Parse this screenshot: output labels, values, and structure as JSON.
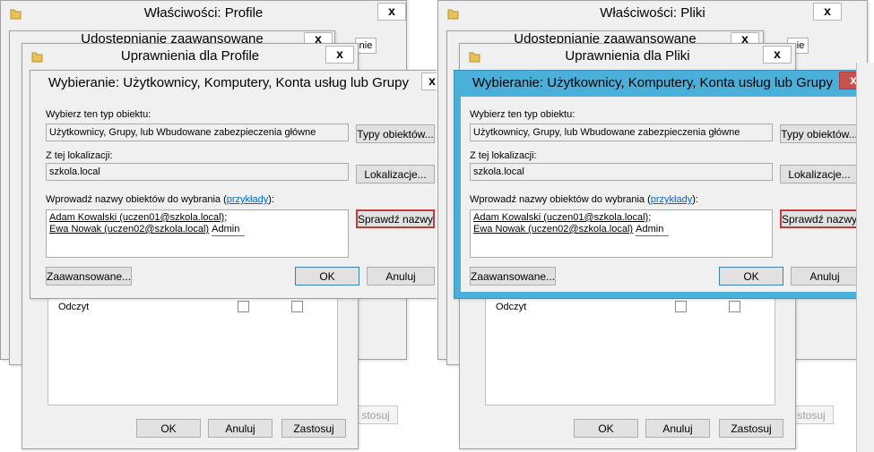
{
  "left": {
    "properties_title": "Właściwości: Profile",
    "advanced_title": "Udostępnianie zaawansowane",
    "permissions_title": "Uprawnienia dla Profile",
    "chooser_title": "Wybieranie: Użytkownicy, Komputery, Konta usług lub Grupy",
    "tab_fragment": "nie",
    "close_label": "x",
    "object_type_label": "Wybierz ten typ obiektu:",
    "object_type_value": "Użytkownicy, Grupy, lub Wbudowane zabezpieczenia główne",
    "object_types_button": "Typy obiektów...",
    "location_label": "Z tej lokalizacji:",
    "location_value": "szkola.local",
    "locations_button": "Lokalizacje...",
    "names_label_pre": "Wprowadź nazwy obiektów do wybrania (",
    "names_label_link": "przykłady",
    "names_label_post": "):",
    "entry1": "Adam Kowalski (uczen01@szkola.local)",
    "entry1_sep": ";",
    "entry2": "Ewa Nowak (uczen02@szkola.local)",
    "entry3": "Admin",
    "check_names_button": "Sprawdź nazwy",
    "advanced_button": "Zaawansowane...",
    "ok_button": "OK",
    "cancel_button": "Anuluj",
    "perm_row_label": "Odczyt",
    "perm_ok": "OK",
    "perm_cancel": "Anuluj",
    "perm_apply": "Zastosuj",
    "behind_apply_frag": "stosuj"
  },
  "right": {
    "properties_title": "Właściwości: Pliki",
    "advanced_title": "Udostępnianie zaawansowane",
    "permissions_title": "Uprawnienia dla Pliki",
    "chooser_title": "Wybieranie: Użytkownicy, Komputery, Konta usług lub Grupy",
    "tab_fragment": "nie",
    "close_label": "x",
    "object_type_label": "Wybierz ten typ obiektu:",
    "object_type_value": "Użytkownicy, Grupy, lub Wbudowane zabezpieczenia główne",
    "object_types_button": "Typy obiektów...",
    "location_label": "Z tej lokalizacji:",
    "location_value": "szkola.local",
    "locations_button": "Lokalizacje...",
    "names_label_pre": "Wprowadź nazwy obiektów do wybrania (",
    "names_label_link": "przykłady",
    "names_label_post": "):",
    "entry1": "Adam Kowalski (uczen01@szkola.local)",
    "entry1_sep": ";",
    "entry2": "Ewa Nowak (uczen02@szkola.local)",
    "entry3": "Admin",
    "check_names_button": "Sprawdź nazwy",
    "advanced_button": "Zaawansowane...",
    "ok_button": "OK",
    "cancel_button": "Anuluj",
    "perm_row_label": "Odczyt",
    "perm_ok": "OK",
    "perm_cancel": "Anuluj",
    "perm_apply": "Zastosuj",
    "behind_apply_frag": "stosuj"
  },
  "colors": {
    "active_title": "#4ab0d9",
    "close_active": "#c75050",
    "highlight_border": "#c23b3b",
    "link": "#0066cc"
  },
  "icons": {
    "folder": "folder-icon",
    "close": "close-icon"
  }
}
